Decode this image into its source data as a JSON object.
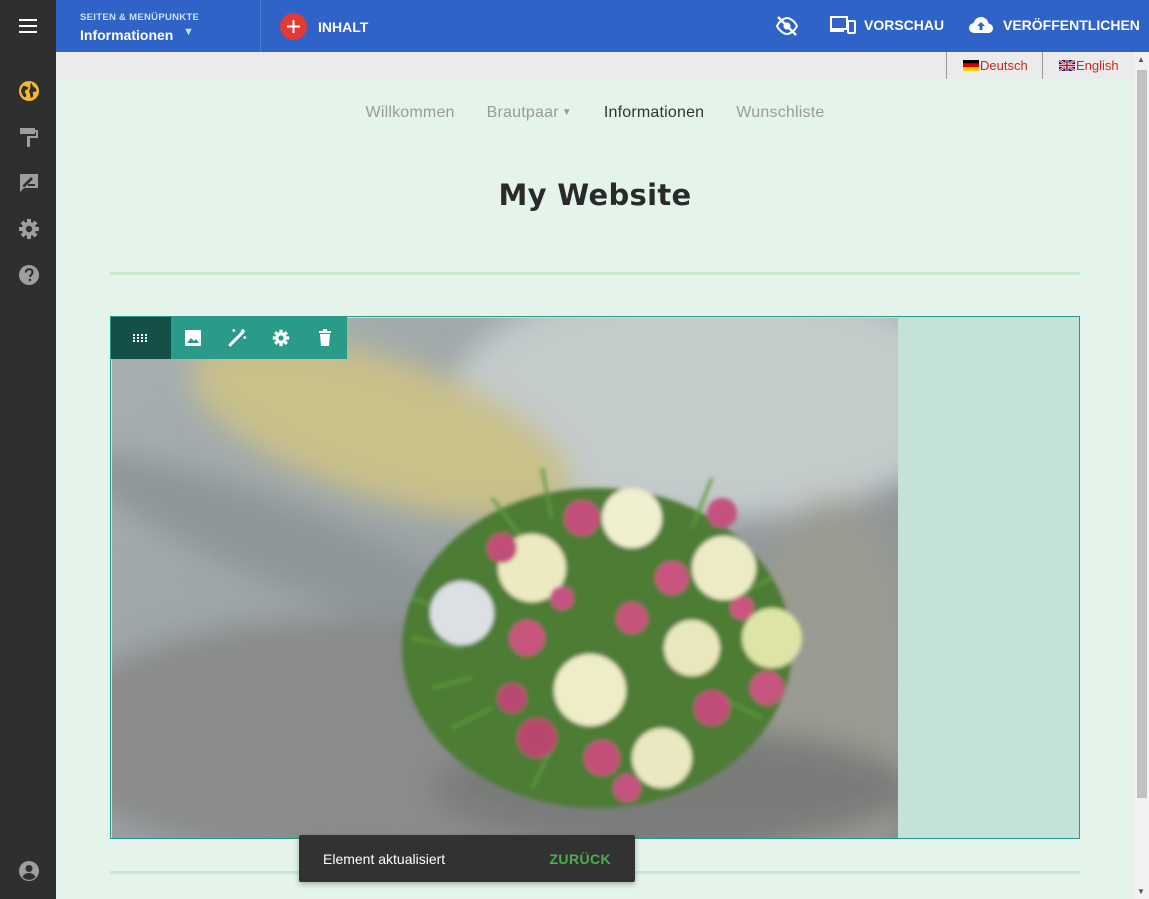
{
  "topbar": {
    "pages_label": "SEITEN & MENÜPUNKTE",
    "current_page": "Informationen",
    "add_content_label": "INHALT",
    "preview_label": "VORSCHAU",
    "publish_label": "VERÖFFENTLICHEN"
  },
  "languages": [
    "Deutsch",
    "English"
  ],
  "nav": {
    "items": [
      "Willkommen",
      "Brautpaar",
      "Informationen",
      "Wunschliste"
    ]
  },
  "site": {
    "title": "My Website"
  },
  "snackbar": {
    "message": "Element aktualisiert",
    "action": "ZURÜCK"
  },
  "colors": {
    "topbar": "#2f63c8",
    "sidebar": "#2f2f2f",
    "page_background": "#e4f4ea",
    "active_sidebar_icon": "#f5b82e",
    "block_toolbar": "#2a9b89",
    "snackbar_action": "#4caf50"
  }
}
